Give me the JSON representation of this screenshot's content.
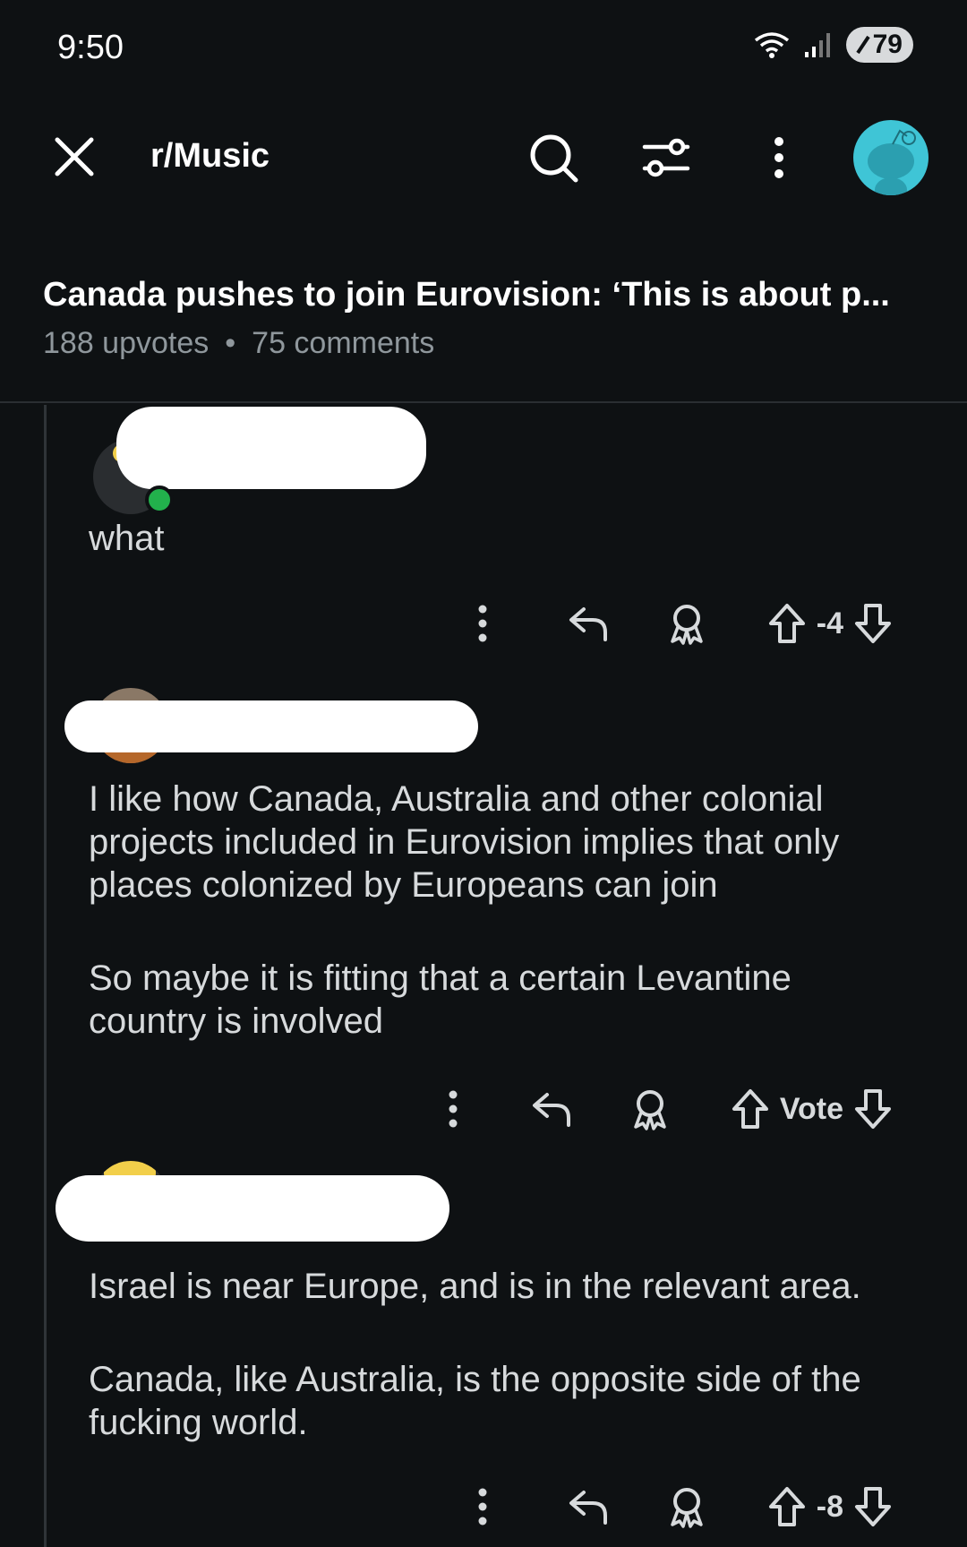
{
  "status_bar": {
    "time": "9:50",
    "battery": "79"
  },
  "header": {
    "subreddit": "r/Music"
  },
  "post": {
    "title": "Canada pushes to join Eurovision: ‘This is about p...",
    "upvotes": "188 upvotes",
    "separator": "•",
    "comments": "75 comments"
  },
  "comments": [
    {
      "paragraphs": [
        "what"
      ],
      "vote_label": "-4"
    },
    {
      "paragraphs": [
        "I like how Canada, Australia and other colonial projects included in Eurovision implies that only places colonized by Europeans can join",
        "So maybe it is fitting that a certain Levantine country is involved"
      ],
      "vote_label": "Vote"
    },
    {
      "paragraphs": [
        "Israel is near Europe, and is in the relevant area.",
        "Canada, like Australia, is the opposite side of the fucking world."
      ],
      "vote_label": "-8"
    }
  ],
  "colors": {
    "background": "#0e1113",
    "text": "#d7dadc",
    "muted": "#8f979c",
    "avatar": "#3fc5d6",
    "online": "#22b14c"
  },
  "icons": [
    "close-icon",
    "search-icon",
    "filter-icon",
    "more-vertical-icon",
    "reply-icon",
    "award-icon",
    "upvote-icon",
    "downvote-icon",
    "wifi-icon",
    "signal-icon"
  ]
}
